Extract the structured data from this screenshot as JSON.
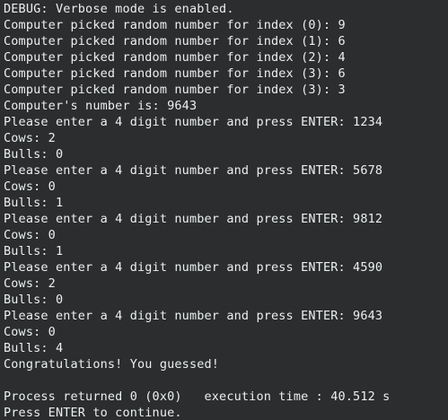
{
  "terminal": {
    "lines": [
      "DEBUG: Verbose mode is enabled.",
      "Computer picked random number for index (0): 9",
      "Computer picked random number for index (1): 6",
      "Computer picked random number for index (2): 4",
      "Computer picked random number for index (3): 6",
      "Computer picked random number for index (3): 3",
      "Computer's number is: 9643",
      "Please enter a 4 digit number and press ENTER: 1234",
      "Cows: 2",
      "Bulls: 0",
      "Please enter a 4 digit number and press ENTER: 5678",
      "Cows: 0",
      "Bulls: 1",
      "Please enter a 4 digit number and press ENTER: 9812",
      "Cows: 0",
      "Bulls: 1",
      "Please enter a 4 digit number and press ENTER: 4590",
      "Cows: 2",
      "Bulls: 0",
      "Please enter a 4 digit number and press ENTER: 9643",
      "Cows: 0",
      "Bulls: 4",
      "Congratulations! You guessed!",
      "",
      "Process returned 0 (0x0)   execution time : 40.512 s",
      "Press ENTER to continue."
    ]
  }
}
